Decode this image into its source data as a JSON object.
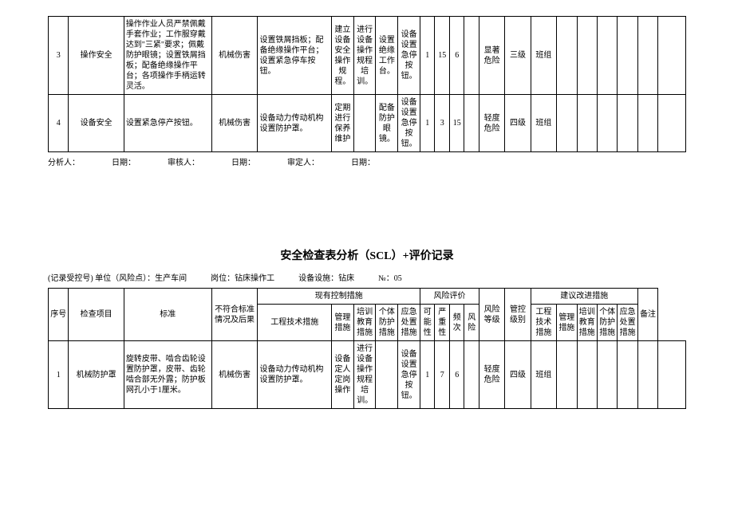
{
  "table1": {
    "rows": [
      {
        "seq": "3",
        "item": "操作安全",
        "std": "操作作业人员严禁佩戴手套作业；工作服穿戴达到\"三紧\"要求；佩戴防护眼镜；设置铁屑挡板；配备绝缘操作平台；各项操作手柄运转灵活。",
        "nonconf": "机械伤害",
        "eng": "设置铁屑挡板；配备绝缘操作平台；设置紧急停车按钮。",
        "mgmt": "建立设备安全操作规程。",
        "train": "进行设备操作规程培训。",
        "ppe": "设置绝缘工作台。",
        "emerg": "设备设置急停按钮。",
        "l": "1",
        "s": "15",
        "f": "6",
        "r": "",
        "risk": "显著危险",
        "level": "三级",
        "ctrl": "班组",
        "s1": "",
        "s2": "",
        "s3": "",
        "s4": "",
        "s5": "",
        "remark": ""
      },
      {
        "seq": "4",
        "item": "设备安全",
        "std": "设置紧急停产按钮。",
        "nonconf": "机械伤害",
        "eng": "设备动力传动机构设置防护罩。",
        "mgmt": "定期进行保养维护",
        "train": "",
        "ppe": "配备防护眼镜。",
        "emerg": "设备设置急停按钮。",
        "l": "1",
        "s": "3",
        "f": "15",
        "r": "",
        "risk": "轻度危险",
        "level": "四级",
        "ctrl": "班组",
        "s1": "",
        "s2": "",
        "s3": "",
        "s4": "",
        "s5": "",
        "remark": ""
      }
    ]
  },
  "footer": {
    "analyst": "分析人：",
    "date1": "日期：",
    "reviewer": "审核人：",
    "date2": "日期：",
    "approver": "审定人：",
    "date3": "日期："
  },
  "section2": {
    "title": "安全检查表分析（SCL）+评价记录",
    "meta": {
      "unit": "(记录受控号) 单位（风险点）：生产车间",
      "post": "岗位：钻床操作工",
      "equip": "设备设施：钻床",
      "num": "№：05"
    },
    "headers": {
      "seq": "序号",
      "item": "检查项目",
      "std": "标准",
      "nonconf": "不符合标准情况及后果",
      "existing": "现有控制措施",
      "eng": "工程技术措施",
      "mgmt": "管理措施",
      "train": "培训教育措施",
      "ppe": "个体防护措施",
      "emerg": "应急处置措施",
      "riskeval": "风险评价",
      "l": "可能性",
      "s": "严重性",
      "f": "频次",
      "r": "风险",
      "risklevel": "风险等级",
      "ctrllevel": "管控级别",
      "suggest": "建议改进措施",
      "seng": "工程技术措施",
      "smgmt": "管理措施",
      "strain": "培训教育措施",
      "sppe": "个体防护措施",
      "semerg": "应急处置措施",
      "remark": "备注"
    },
    "rows": [
      {
        "seq": "1",
        "item": "机械防护罩",
        "std": "旋转皮带、啮合齿轮设置防护罩，皮带、齿轮啮合部无外露；防护板网孔小于1厘米。",
        "nonconf": "机械伤害",
        "eng": "设备动力传动机构设置防护罩。",
        "mgmt": "设备定人定岗操作",
        "train": "进行设备操作规程培训。",
        "ppe": "",
        "emerg": "设备设置急停按钮。",
        "l": "1",
        "s": "7",
        "f": "6",
        "r": "",
        "risk": "轻度危险",
        "level": "四级",
        "ctrl": "班组",
        "s1": "",
        "s2": "",
        "s3": "",
        "s4": "",
        "s5": "",
        "remark": ""
      }
    ]
  }
}
